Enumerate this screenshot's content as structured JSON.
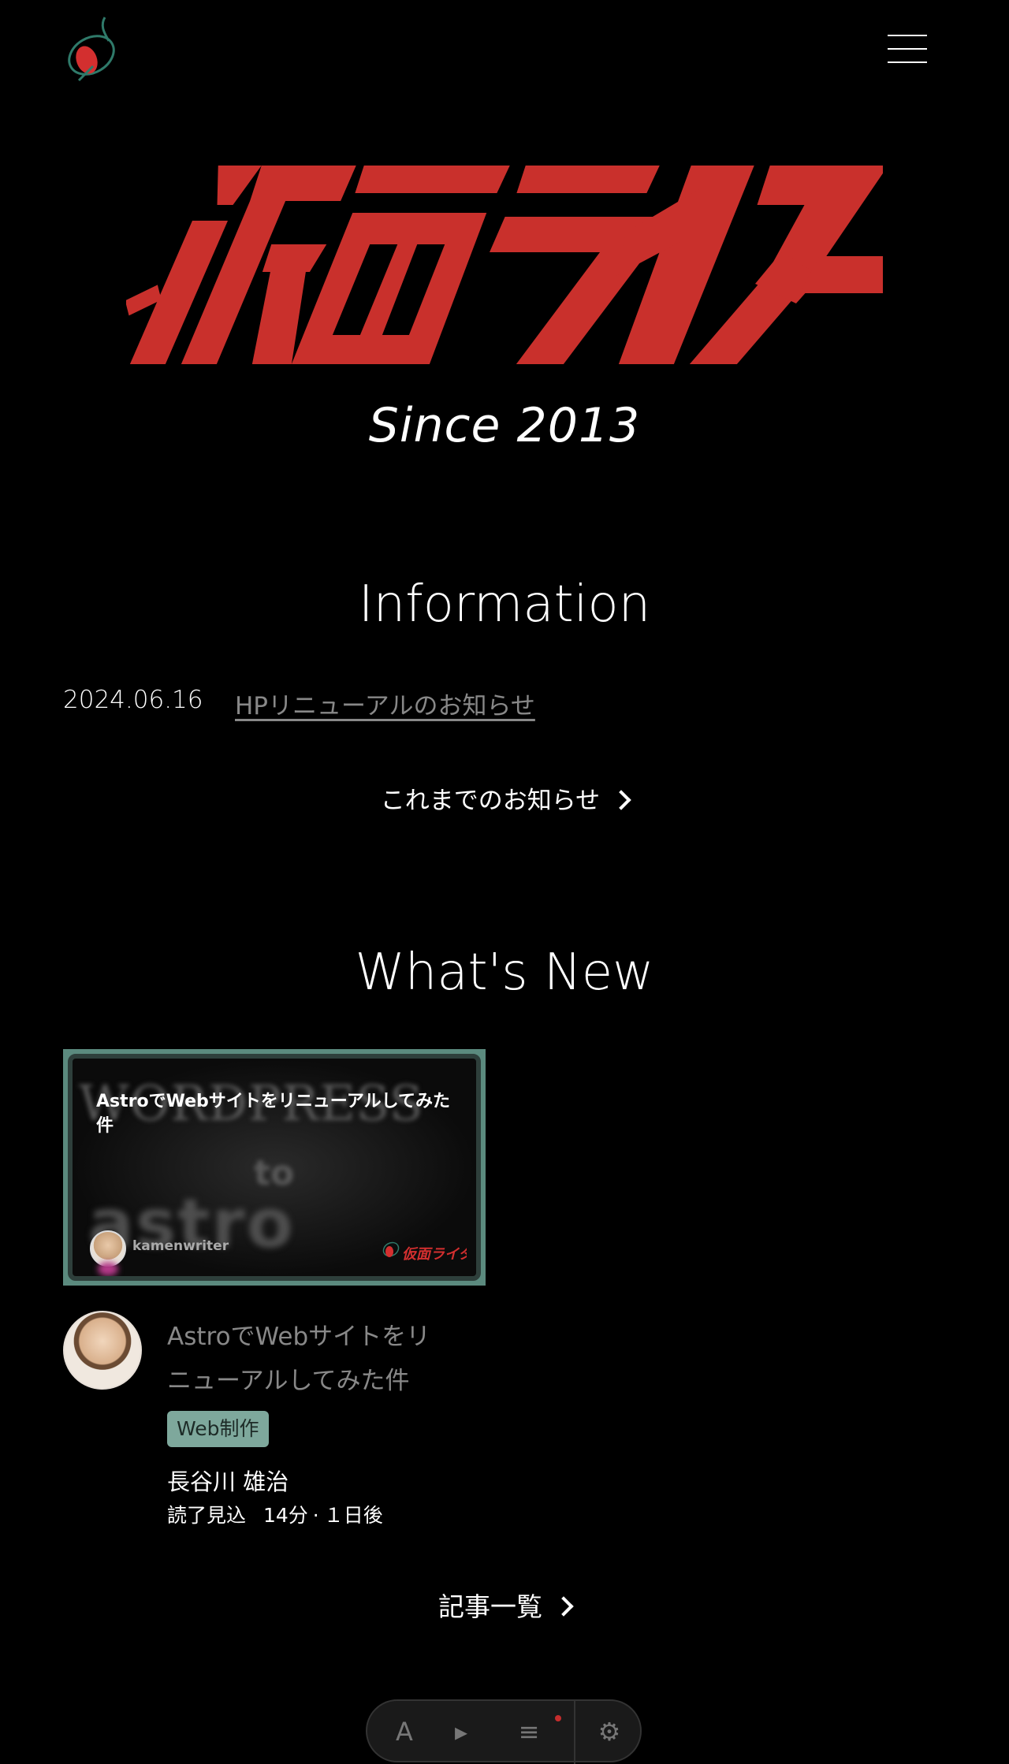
{
  "header": {
    "logo_alt": "",
    "menu_label": ""
  },
  "hero": {
    "title": "仮面ライター",
    "since": "Since 2013"
  },
  "information": {
    "heading": "Information",
    "items": [
      {
        "date": "2024.06.16",
        "title": "HPリニューアルのお知らせ"
      }
    ],
    "more_label": "これまでのお知らせ"
  },
  "whats_new": {
    "heading": "What's New",
    "posts": [
      {
        "thumbnail_title": "AstroでWebサイトをリニューアルしてみた件",
        "thumbnail_wordpress_text": "WORDPRESS",
        "thumbnail_to_text": "to",
        "thumbnail_astro_text": "astro",
        "thumbnail_username": "kamenwriter",
        "thumbnail_brand": "仮面ライター",
        "title": "AstroでWebサイトをリニューアルしてみた件",
        "tag": "Web制作",
        "author": "長谷川 雄治",
        "read_label": "読了見込",
        "read_time": "14分",
        "separator": "·",
        "published": "１日後"
      }
    ],
    "more_label": "記事一覧"
  },
  "colors": {
    "brand_red": "#c9302c",
    "tag_green": "#7ea89c",
    "thumb_frame": "#5b8a7e",
    "background": "#000000"
  },
  "icons": {
    "logo": "kamen-logo-icon",
    "menu": "hamburger-icon",
    "chevron": "chevron-right-icon"
  }
}
